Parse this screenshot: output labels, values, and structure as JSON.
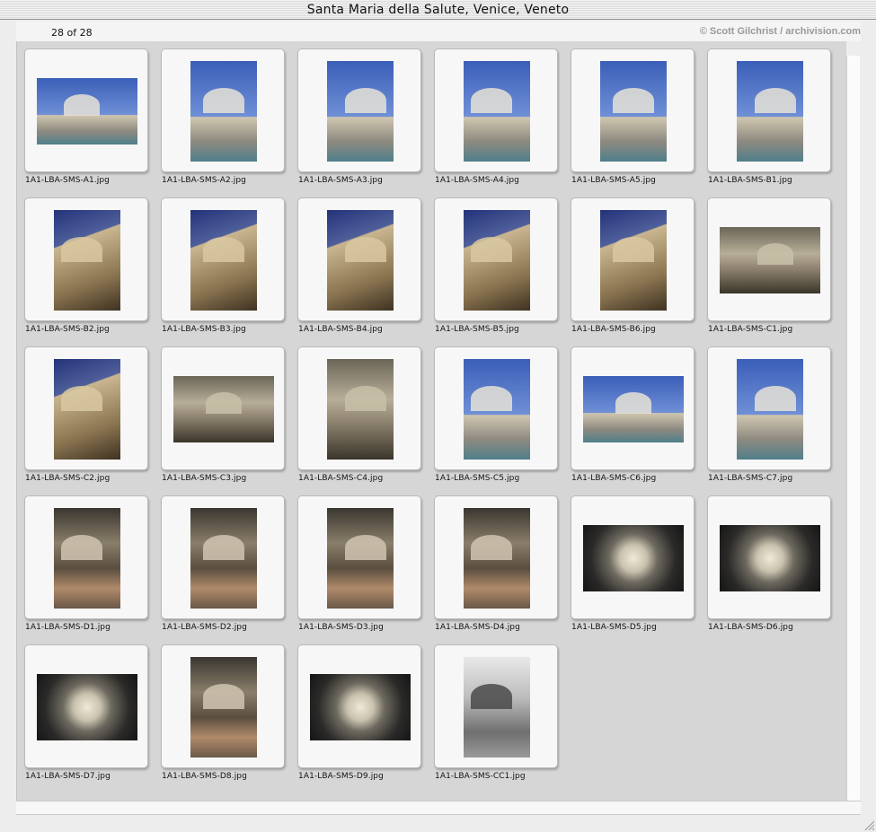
{
  "window": {
    "title": "Santa Maria della Salute, Venice, Veneto"
  },
  "header": {
    "counter": "28 of 28",
    "credit": "© Scott Gilchrist / archivision.com"
  },
  "images": [
    {
      "file": "1A1-LBA-SMS-A1.jpg",
      "orient": "land",
      "theme": "sky"
    },
    {
      "file": "1A1-LBA-SMS-A2.jpg",
      "orient": "port",
      "theme": "sky"
    },
    {
      "file": "1A1-LBA-SMS-A3.jpg",
      "orient": "port",
      "theme": "sky"
    },
    {
      "file": "1A1-LBA-SMS-A4.jpg",
      "orient": "port",
      "theme": "sky"
    },
    {
      "file": "1A1-LBA-SMS-A5.jpg",
      "orient": "port",
      "theme": "sky"
    },
    {
      "file": "1A1-LBA-SMS-B1.jpg",
      "orient": "port",
      "theme": "sky"
    },
    {
      "file": "1A1-LBA-SMS-B2.jpg",
      "orient": "port",
      "theme": "facade"
    },
    {
      "file": "1A1-LBA-SMS-B3.jpg",
      "orient": "port",
      "theme": "facade"
    },
    {
      "file": "1A1-LBA-SMS-B4.jpg",
      "orient": "port",
      "theme": "facade"
    },
    {
      "file": "1A1-LBA-SMS-B5.jpg",
      "orient": "port",
      "theme": "facade"
    },
    {
      "file": "1A1-LBA-SMS-B6.jpg",
      "orient": "port",
      "theme": "facade"
    },
    {
      "file": "1A1-LBA-SMS-C1.jpg",
      "orient": "land",
      "theme": "stone"
    },
    {
      "file": "1A1-LBA-SMS-C2.jpg",
      "orient": "port",
      "theme": "facade"
    },
    {
      "file": "1A1-LBA-SMS-C3.jpg",
      "orient": "land",
      "theme": "stone"
    },
    {
      "file": "1A1-LBA-SMS-C4.jpg",
      "orient": "port",
      "theme": "stone"
    },
    {
      "file": "1A1-LBA-SMS-C5.jpg",
      "orient": "port",
      "theme": "sky"
    },
    {
      "file": "1A1-LBA-SMS-C6.jpg",
      "orient": "land",
      "theme": "sky"
    },
    {
      "file": "1A1-LBA-SMS-C7.jpg",
      "orient": "port",
      "theme": "sky"
    },
    {
      "file": "1A1-LBA-SMS-D1.jpg",
      "orient": "port",
      "theme": "interior"
    },
    {
      "file": "1A1-LBA-SMS-D2.jpg",
      "orient": "port",
      "theme": "interior"
    },
    {
      "file": "1A1-LBA-SMS-D3.jpg",
      "orient": "port",
      "theme": "interior"
    },
    {
      "file": "1A1-LBA-SMS-D4.jpg",
      "orient": "port",
      "theme": "interior"
    },
    {
      "file": "1A1-LBA-SMS-D5.jpg",
      "orient": "land",
      "theme": "dome"
    },
    {
      "file": "1A1-LBA-SMS-D6.jpg",
      "orient": "land",
      "theme": "dome"
    },
    {
      "file": "1A1-LBA-SMS-D7.jpg",
      "orient": "land",
      "theme": "dome"
    },
    {
      "file": "1A1-LBA-SMS-D8.jpg",
      "orient": "port",
      "theme": "interior"
    },
    {
      "file": "1A1-LBA-SMS-D9.jpg",
      "orient": "land",
      "theme": "dome"
    },
    {
      "file": "1A1-LBA-SMS-CC1.jpg",
      "orient": "port",
      "theme": "bw"
    }
  ]
}
